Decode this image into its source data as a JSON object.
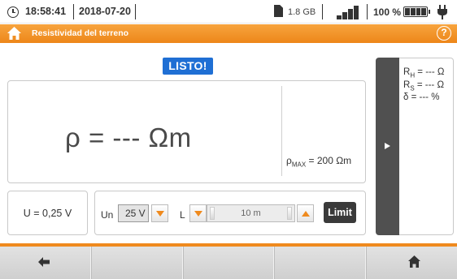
{
  "status": {
    "time": "18:58:41",
    "date": "2018-07-20",
    "memory": "1.8 GB",
    "battery": "100 %",
    "icons": [
      "clock-icon",
      "sd-card-icon",
      "signal-icon",
      "battery-icon",
      "plug-icon"
    ]
  },
  "header": {
    "title": "Resistividad del terreno",
    "help_label": "?",
    "home_icon": "home-icon",
    "color": "#ef8a1e"
  },
  "main": {
    "status_badge": "LISTO!",
    "badge_color": "#1f6fd4",
    "result": "ρ = --- Ωm",
    "rho_max_prefix": "ρ",
    "rho_max_sub": "MAX",
    "rho_max_value": " = 200 Ωm",
    "voltage": "U = 0,25 V"
  },
  "controls": {
    "un_label": "Un",
    "un_value": "25 V",
    "l_label": "L",
    "l_value": "10 m",
    "limit_label": "Limit"
  },
  "side_panel": {
    "rh_prefix": "R",
    "rh_sub": "H",
    "rh_value": " = --- Ω",
    "rs_prefix": "R",
    "rs_sub": "S",
    "rs_value": " = --- Ω",
    "delta": "δ  = --- %"
  },
  "nav": {
    "buttons": [
      "back-icon",
      "",
      "",
      "",
      "home-icon"
    ]
  }
}
